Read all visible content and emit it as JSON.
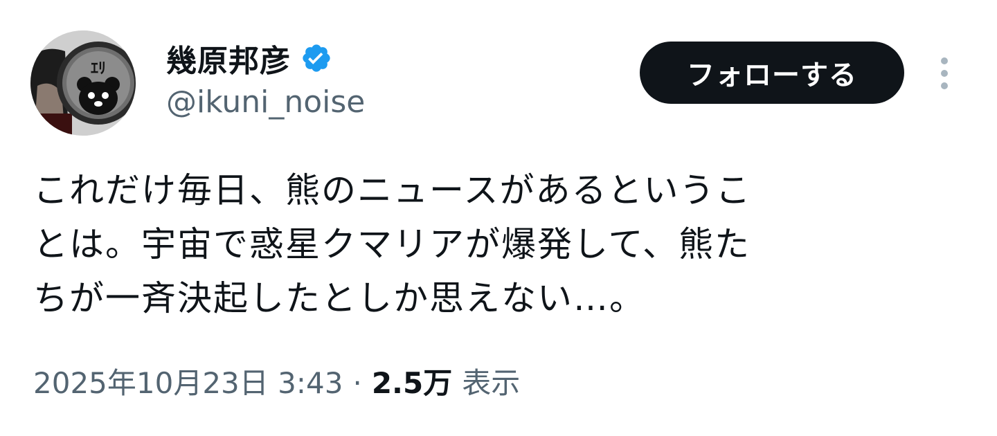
{
  "author": {
    "display_name": "幾原邦彦",
    "handle": "@ikuni_noise",
    "verified_icon": "verified-badge-icon",
    "verified_color": "#1d9bf0",
    "avatar_badge_text": "ｴﾘ"
  },
  "follow_button": {
    "label": "フォローする",
    "bg": "#0f1419",
    "fg": "#ffffff"
  },
  "more_icon": "more-vertical-icon",
  "tweet": {
    "text": "これだけ毎日、熊のニュースがあるというこ\nとは。宇宙で惑星クマリアが爆発して、熊た\nちが一斉決起したとしか思えない…。"
  },
  "meta": {
    "date": "2025年10月23日 3:43",
    "separator": "·",
    "views_count": "2.5万",
    "views_label": "表示"
  }
}
